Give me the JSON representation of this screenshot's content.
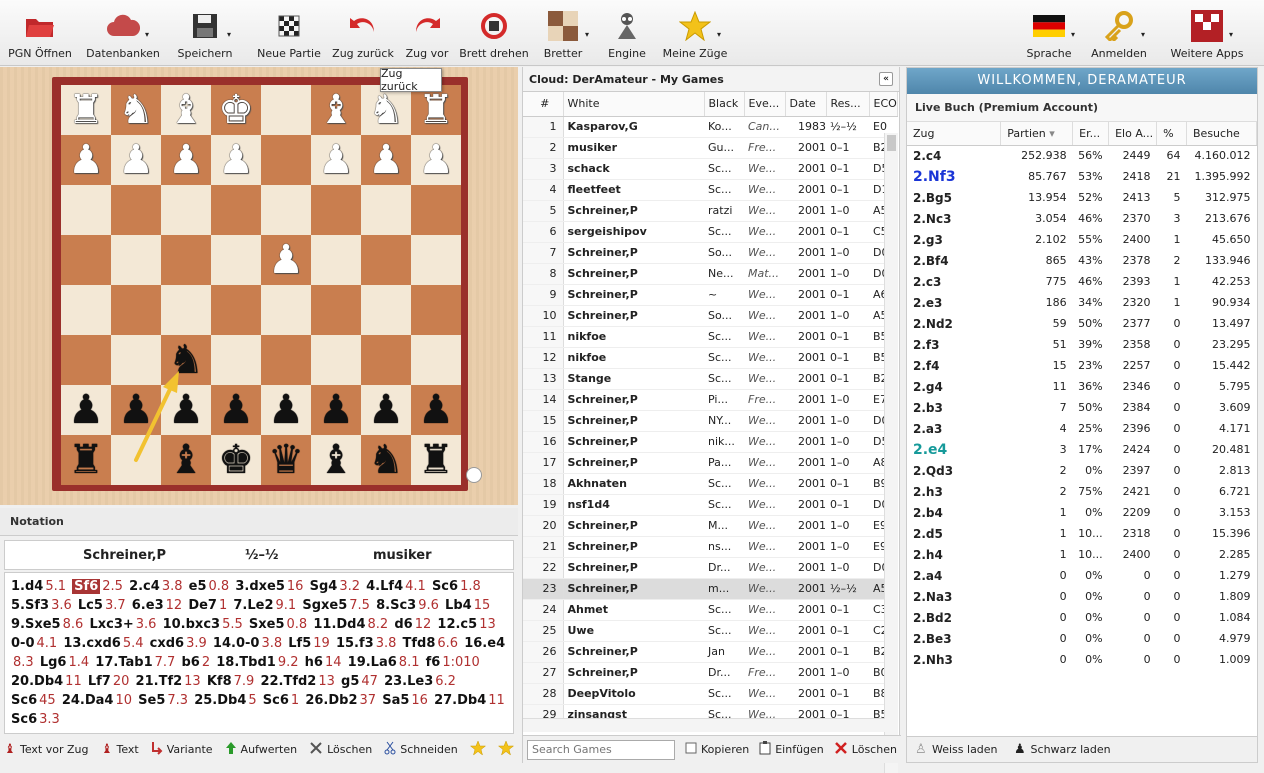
{
  "toolbar": {
    "left": [
      {
        "label": "PGN Öffnen",
        "icon": "open-folder-icon",
        "dropdown": false
      },
      {
        "label": "Datenbanken",
        "icon": "cloud-icon",
        "dropdown": true
      },
      {
        "label": "Speichern",
        "icon": "floppy-disk-icon",
        "dropdown": true
      },
      {
        "label": "Neue Partie",
        "icon": "new-board-icon",
        "dropdown": false
      },
      {
        "label": "Zug zurück",
        "icon": "undo-arrow-icon",
        "dropdown": false
      },
      {
        "label": "Zug vor",
        "icon": "redo-arrow-icon",
        "dropdown": false
      },
      {
        "label": "Brett drehen",
        "icon": "rotate-board-icon",
        "dropdown": false
      },
      {
        "label": "Bretter",
        "icon": "boards-icon",
        "dropdown": true
      },
      {
        "label": "Engine",
        "icon": "engine-icon",
        "dropdown": false
      },
      {
        "label": "Meine Züge",
        "icon": "star-icon",
        "dropdown": true
      }
    ],
    "right": [
      {
        "label": "Sprache",
        "icon": "german-flag-icon",
        "dropdown": true
      },
      {
        "label": "Anmelden",
        "icon": "key-icon",
        "dropdown": true
      },
      {
        "label": "Weitere Apps",
        "icon": "chessbase-logo-icon",
        "dropdown": true
      }
    ]
  },
  "tooltip": "Zug zurück",
  "board": {
    "rank8": [
      "♜",
      "♞",
      "♝",
      "♚",
      "",
      "♝",
      "♞",
      "♜"
    ],
    "rank8_color": [
      "w",
      "w",
      "w",
      "w",
      "",
      "w",
      "w",
      "w"
    ],
    "rank7": [
      "♟",
      "♟",
      "♟",
      "",
      "",
      "♟",
      "♟",
      "♟"
    ],
    "rank6": [
      "",
      "",
      "",
      "",
      "",
      "",
      "",
      ""
    ],
    "rank5": [
      "",
      "",
      "",
      "",
      "♟",
      "",
      "",
      ""
    ],
    "rank4": [
      "",
      "",
      "",
      "",
      "",
      "",
      "",
      ""
    ],
    "rank3": [
      "",
      "",
      "♞",
      "",
      "",
      "",
      "",
      ""
    ],
    "rank2": [
      "♟",
      "♟",
      "♟",
      "♟",
      "♟",
      "♟",
      "♟",
      "♟"
    ],
    "rank1": [
      "♜",
      "",
      "♝",
      "♚",
      "♛",
      "♝",
      "♞",
      "♜"
    ],
    "pieces": [
      {
        "sq": [
          0,
          0
        ],
        "p": "♜",
        "c": "w"
      },
      {
        "sq": [
          0,
          1
        ],
        "p": "♞",
        "c": "w"
      },
      {
        "sq": [
          0,
          2
        ],
        "p": "♝",
        "c": "w"
      },
      {
        "sq": [
          0,
          3
        ],
        "p": "♚",
        "c": "w"
      },
      {
        "sq": [
          0,
          5
        ],
        "p": "♝",
        "c": "w"
      },
      {
        "sq": [
          0,
          6
        ],
        "p": "♞",
        "c": "w"
      },
      {
        "sq": [
          0,
          7
        ],
        "p": "♜",
        "c": "w"
      },
      {
        "sq": [
          1,
          0
        ],
        "p": "♟",
        "c": "w"
      },
      {
        "sq": [
          1,
          1
        ],
        "p": "♟",
        "c": "w"
      },
      {
        "sq": [
          1,
          2
        ],
        "p": "♟",
        "c": "w"
      },
      {
        "sq": [
          1,
          3
        ],
        "p": "♟",
        "c": "w"
      },
      {
        "sq": [
          1,
          5
        ],
        "p": "♟",
        "c": "w"
      },
      {
        "sq": [
          1,
          6
        ],
        "p": "♟",
        "c": "w"
      },
      {
        "sq": [
          1,
          7
        ],
        "p": "♟",
        "c": "w"
      },
      {
        "sq": [
          3,
          4
        ],
        "p": "♟",
        "c": "w"
      },
      {
        "sq": [
          5,
          2
        ],
        "p": "♞",
        "c": "b"
      },
      {
        "sq": [
          6,
          0
        ],
        "p": "♟",
        "c": "b"
      },
      {
        "sq": [
          6,
          1
        ],
        "p": "♟",
        "c": "b"
      },
      {
        "sq": [
          6,
          2
        ],
        "p": "♟",
        "c": "b"
      },
      {
        "sq": [
          6,
          3
        ],
        "p": "♟",
        "c": "b"
      },
      {
        "sq": [
          6,
          4
        ],
        "p": "♟",
        "c": "b"
      },
      {
        "sq": [
          6,
          5
        ],
        "p": "♟",
        "c": "b"
      },
      {
        "sq": [
          6,
          6
        ],
        "p": "♟",
        "c": "b"
      },
      {
        "sq": [
          6,
          7
        ],
        "p": "♟",
        "c": "b"
      },
      {
        "sq": [
          7,
          0
        ],
        "p": "♜",
        "c": "b"
      },
      {
        "sq": [
          7,
          2
        ],
        "p": "♝",
        "c": "b"
      },
      {
        "sq": [
          7,
          3
        ],
        "p": "♚",
        "c": "b"
      },
      {
        "sq": [
          7,
          4
        ],
        "p": "♛",
        "c": "b"
      },
      {
        "sq": [
          7,
          5
        ],
        "p": "♝",
        "c": "b"
      },
      {
        "sq": [
          7,
          6
        ],
        "p": "♞",
        "c": "b"
      },
      {
        "sq": [
          7,
          7
        ],
        "p": "♜",
        "c": "b"
      }
    ],
    "arrow_color": "#f2c230",
    "frame_color": "#9a2f2b"
  },
  "notation": {
    "header": "Notation",
    "white": "Schreiner,P",
    "result": "½–½",
    "black": "musiker",
    "moves": [
      [
        "1.d4",
        "5.1"
      ],
      [
        "Sf6",
        "2.5",
        "cur"
      ],
      [
        "2.c4",
        "3.8"
      ],
      [
        "e5",
        "0.8"
      ],
      [
        "3.dxe5",
        "16"
      ],
      [
        "Sg4",
        "3.2"
      ],
      [
        "4.Lf4",
        "4.1"
      ],
      [
        "Sc6",
        "1.8"
      ],
      [
        "5.Sf3",
        "3.6"
      ],
      [
        "Lc5",
        "3.7"
      ],
      [
        "6.e3",
        "12"
      ],
      [
        "De7",
        "1"
      ],
      [
        "7.Le2",
        "9.1"
      ],
      [
        "Sgxe5",
        "7.5"
      ],
      [
        "8.Sc3",
        "9.6"
      ],
      [
        "Lb4",
        "15"
      ],
      [
        "9.Sxe5",
        "8.6"
      ],
      [
        "Lxc3+",
        "3.6"
      ],
      [
        "10.bxc3",
        "5.5"
      ],
      [
        "Sxe5",
        "0.8"
      ],
      [
        "11.Dd4",
        "8.2"
      ],
      [
        "d6",
        "12"
      ],
      [
        "12.c5",
        "13"
      ],
      [
        "0-0",
        "4.1"
      ],
      [
        "13.cxd6",
        "5.4"
      ],
      [
        "cxd6",
        "3.9"
      ],
      [
        "14.0-0",
        "3.8"
      ],
      [
        "Lf5",
        "19"
      ],
      [
        "15.f3",
        "3.8"
      ],
      [
        "Tfd8",
        "6.6"
      ],
      [
        "16.e4",
        ""
      ],
      [
        "",
        "8.3"
      ],
      [
        "Lg6",
        "1.4"
      ],
      [
        "17.Tab1",
        "7.7"
      ],
      [
        "b6",
        "2"
      ],
      [
        "18.Tbd1",
        "9.2"
      ],
      [
        "h6",
        "14"
      ],
      [
        "19.La6",
        "8.1"
      ],
      [
        "f6",
        "1:010"
      ],
      [
        "20.Db4",
        "11"
      ],
      [
        "Lf7",
        "20"
      ],
      [
        "21.Tf2",
        "13"
      ],
      [
        "Kf8",
        "7.9"
      ],
      [
        "22.Tfd2",
        "13"
      ],
      [
        "g5",
        "47"
      ],
      [
        "23.Le3",
        "6.2"
      ],
      [
        "Sc6",
        "45"
      ],
      [
        "24.Da4",
        "10"
      ],
      [
        "Se5",
        "7.3"
      ],
      [
        "25.Db4",
        "5"
      ],
      [
        "Sc6",
        "1"
      ],
      [
        "26.Db2",
        "37"
      ],
      [
        "Sa5",
        "16"
      ],
      [
        "27.Db4",
        "11"
      ],
      [
        "Sc6",
        "3.3"
      ]
    ],
    "final": "½–½",
    "toolbar": [
      {
        "label": "Text vor Zug",
        "icon": "text-before-move-icon"
      },
      {
        "label": "Text",
        "icon": "text-icon"
      },
      {
        "label": "Variante",
        "icon": "variation-icon"
      },
      {
        "label": "Aufwerten",
        "icon": "promote-icon"
      },
      {
        "label": "Löschen",
        "icon": "delete-icon"
      },
      {
        "label": "Schneiden",
        "icon": "scissors-icon"
      }
    ]
  },
  "games": {
    "title": "Cloud: DerAmateur - My Games",
    "columns": [
      "#",
      "White",
      "Black",
      "Eve...",
      "Date",
      "Res...",
      "ECO"
    ],
    "rows": [
      [
        "1",
        "Kasparov,G",
        "Ko...",
        "Can...",
        "1983",
        "½–½",
        "E0"
      ],
      [
        "2",
        "musiker",
        "Gu...",
        "Fre...",
        "2001",
        "0–1",
        "B2"
      ],
      [
        "3",
        "schack",
        "Sc...",
        "We...",
        "2001",
        "0–1",
        "D5"
      ],
      [
        "4",
        "fleetfeet",
        "Sc...",
        "We...",
        "2001",
        "0–1",
        "D1"
      ],
      [
        "5",
        "Schreiner,P",
        "ratzi",
        "We...",
        "2001",
        "1–0",
        "A5"
      ],
      [
        "6",
        "sergeishipov",
        "Sc...",
        "We...",
        "2001",
        "0–1",
        "C5"
      ],
      [
        "7",
        "Schreiner,P",
        "So...",
        "We...",
        "2001",
        "1–0",
        "D0"
      ],
      [
        "8",
        "Schreiner,P",
        "Ne...",
        "Mat...",
        "2001",
        "1–0",
        "D0"
      ],
      [
        "9",
        "Schreiner,P",
        "~",
        "We...",
        "2001",
        "0–1",
        "A6"
      ],
      [
        "10",
        "Schreiner,P",
        "So...",
        "We...",
        "2001",
        "1–0",
        "A5"
      ],
      [
        "11",
        "nikfoe",
        "Sc...",
        "We...",
        "2001",
        "0–1",
        "B5"
      ],
      [
        "12",
        "nikfoe",
        "Sc...",
        "We...",
        "2001",
        "0–1",
        "B5"
      ],
      [
        "13",
        "Stange",
        "Sc...",
        "We...",
        "2001",
        "0–1",
        "B2"
      ],
      [
        "14",
        "Schreiner,P",
        "Pi...",
        "Fre...",
        "2001",
        "1–0",
        "E7"
      ],
      [
        "15",
        "Schreiner,P",
        "NY...",
        "We...",
        "2001",
        "1–0",
        "D0"
      ],
      [
        "16",
        "Schreiner,P",
        "nik...",
        "We...",
        "2001",
        "1–0",
        "D5"
      ],
      [
        "17",
        "Schreiner,P",
        "Pa...",
        "We...",
        "2001",
        "1–0",
        "A8"
      ],
      [
        "18",
        "Akhnaten",
        "Sc...",
        "We...",
        "2001",
        "0–1",
        "B9"
      ],
      [
        "19",
        "nsf1d4",
        "Sc...",
        "We...",
        "2001",
        "0–1",
        "D0"
      ],
      [
        "20",
        "Schreiner,P",
        "M...",
        "We...",
        "2001",
        "1–0",
        "E9"
      ],
      [
        "21",
        "Schreiner,P",
        "ns...",
        "We...",
        "2001",
        "1–0",
        "E9"
      ],
      [
        "22",
        "Schreiner,P",
        "Dr...",
        "We...",
        "2001",
        "1–0",
        "D0"
      ],
      [
        "23",
        "Schreiner,P",
        "m...",
        "We...",
        "2001",
        "½–½",
        "A5"
      ],
      [
        "24",
        "Ahmet",
        "Sc...",
        "We...",
        "2001",
        "0–1",
        "C3"
      ],
      [
        "25",
        "Uwe",
        "Sc...",
        "We...",
        "2001",
        "0–1",
        "C2"
      ],
      [
        "26",
        "Schreiner,P",
        "Jan",
        "We...",
        "2001",
        "0–1",
        "B2"
      ],
      [
        "27",
        "Schreiner,P",
        "Dr...",
        "Fre...",
        "2001",
        "1–0",
        "B0"
      ],
      [
        "28",
        "DeepVitolo",
        "Sc...",
        "We...",
        "2001",
        "0–1",
        "B8"
      ],
      [
        "29",
        "zinsangst",
        "Sc...",
        "We...",
        "2001",
        "0–1",
        "B5"
      ]
    ],
    "selected_row": 22,
    "search_placeholder": "Search Games",
    "toolbar": [
      {
        "label": "Kopieren",
        "icon": "copy-checkbox-icon"
      },
      {
        "label": "Einfügen",
        "icon": "paste-icon"
      },
      {
        "label": "Löschen",
        "icon": "delete-x-icon"
      }
    ]
  },
  "book": {
    "welcome": "WILLKOMMEN, DERAMATEUR",
    "subtitle": "Live Buch (Premium Account)",
    "columns": [
      "Zug",
      "Partien",
      "Er...",
      "Elo A...",
      "%",
      "Besuche"
    ],
    "rows": [
      [
        "2.c4",
        "252.938",
        "56%",
        "2449",
        "64",
        "4.160.012",
        ""
      ],
      [
        "2.Nf3",
        "85.767",
        "53%",
        "2418",
        "21",
        "1.395.992",
        "blue"
      ],
      [
        "2.Bg5",
        "13.954",
        "52%",
        "2413",
        "5",
        "312.975",
        ""
      ],
      [
        "2.Nc3",
        "3.054",
        "46%",
        "2370",
        "3",
        "213.676",
        ""
      ],
      [
        "2.g3",
        "2.102",
        "55%",
        "2400",
        "1",
        "45.650",
        ""
      ],
      [
        "2.Bf4",
        "865",
        "43%",
        "2378",
        "2",
        "133.946",
        ""
      ],
      [
        "2.c3",
        "775",
        "46%",
        "2393",
        "1",
        "42.253",
        ""
      ],
      [
        "2.e3",
        "186",
        "34%",
        "2320",
        "1",
        "90.934",
        ""
      ],
      [
        "2.Nd2",
        "59",
        "50%",
        "2377",
        "0",
        "13.497",
        ""
      ],
      [
        "2.f3",
        "51",
        "39%",
        "2358",
        "0",
        "23.295",
        ""
      ],
      [
        "2.f4",
        "15",
        "23%",
        "2257",
        "0",
        "15.442",
        ""
      ],
      [
        "2.g4",
        "11",
        "36%",
        "2346",
        "0",
        "5.795",
        ""
      ],
      [
        "2.b3",
        "7",
        "50%",
        "2384",
        "0",
        "3.609",
        ""
      ],
      [
        "2.a3",
        "4",
        "25%",
        "2396",
        "0",
        "4.171",
        ""
      ],
      [
        "2.e4",
        "3",
        "17%",
        "2424",
        "0",
        "20.481",
        "teal"
      ],
      [
        "2.Qd3",
        "2",
        "0%",
        "2397",
        "0",
        "2.813",
        ""
      ],
      [
        "2.h3",
        "2",
        "75%",
        "2421",
        "0",
        "6.721",
        ""
      ],
      [
        "2.b4",
        "1",
        "0%",
        "2209",
        "0",
        "3.153",
        ""
      ],
      [
        "2.d5",
        "1",
        "10...",
        "2318",
        "0",
        "15.396",
        ""
      ],
      [
        "2.h4",
        "1",
        "10...",
        "2400",
        "0",
        "2.285",
        ""
      ],
      [
        "2.a4",
        "0",
        "0%",
        "0",
        "0",
        "1.279",
        ""
      ],
      [
        "2.Na3",
        "0",
        "0%",
        "0",
        "0",
        "1.809",
        ""
      ],
      [
        "2.Bd2",
        "0",
        "0%",
        "0",
        "0",
        "1.084",
        ""
      ],
      [
        "2.Be3",
        "0",
        "0%",
        "0",
        "0",
        "4.979",
        ""
      ],
      [
        "2.Nh3",
        "0",
        "0%",
        "0",
        "0",
        "1.009",
        ""
      ]
    ],
    "toolbar": [
      {
        "label": "Weiss laden",
        "icon": "white-pawn-icon"
      },
      {
        "label": "Schwarz laden",
        "icon": "black-pawn-icon"
      }
    ]
  }
}
